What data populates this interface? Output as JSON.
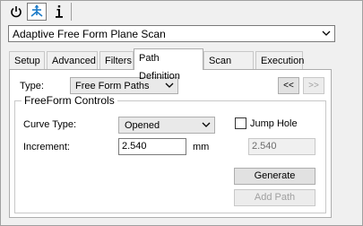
{
  "toolbar": {
    "buttons": [
      {
        "icon": "power-icon",
        "selected": false
      },
      {
        "icon": "move-axes-icon",
        "selected": true
      },
      {
        "icon": "info-icon",
        "selected": false
      }
    ],
    "accent_color": "#1e7cc8"
  },
  "mode": {
    "value": "Adaptive Free Form Plane Scan"
  },
  "tabs": [
    {
      "label": "Setup",
      "active": false
    },
    {
      "label": "Advanced",
      "active": false
    },
    {
      "label": "Filters",
      "active": false
    },
    {
      "label": "Path Definition",
      "active": true
    },
    {
      "label": "Scan Path",
      "active": false
    },
    {
      "label": "Execution",
      "active": false
    }
  ],
  "path_definition": {
    "type_label": "Type:",
    "type_value": "Free Form Paths",
    "prev_label": "<<",
    "next_label": ">>",
    "group_title": "FreeForm Controls",
    "curve_type_label": "Curve Type:",
    "curve_type_value": "Opened",
    "jump_hole_label": "Jump Hole",
    "jump_hole_checked": false,
    "increment_label": "Increment:",
    "increment_value": "2.540",
    "increment_unit": "mm",
    "jump_value": "2.540",
    "generate_label": "Generate",
    "add_path_label": "Add Path"
  }
}
